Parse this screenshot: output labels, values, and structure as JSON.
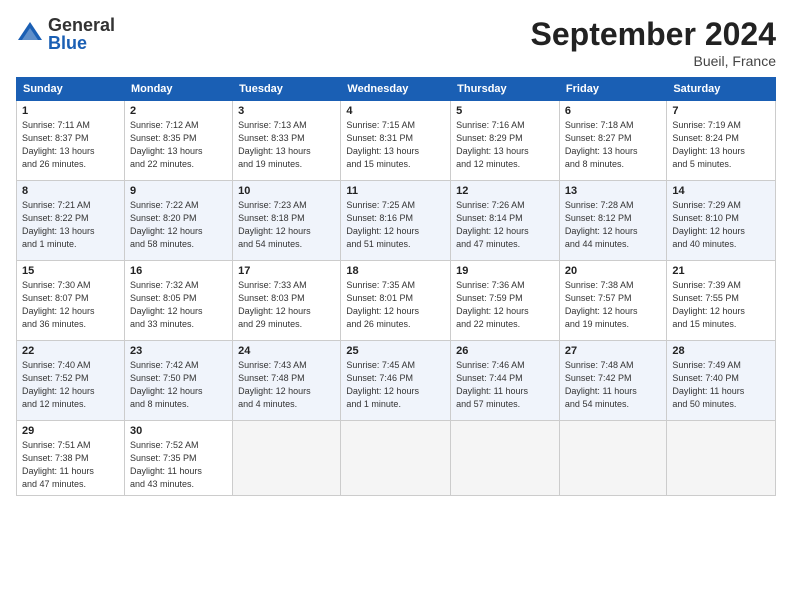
{
  "logo": {
    "general": "General",
    "blue": "Blue"
  },
  "title": "September 2024",
  "location": "Bueil, France",
  "days_of_week": [
    "Sunday",
    "Monday",
    "Tuesday",
    "Wednesday",
    "Thursday",
    "Friday",
    "Saturday"
  ],
  "weeks": [
    [
      {
        "day": "1",
        "info": "Sunrise: 7:11 AM\nSunset: 8:37 PM\nDaylight: 13 hours\nand 26 minutes."
      },
      {
        "day": "2",
        "info": "Sunrise: 7:12 AM\nSunset: 8:35 PM\nDaylight: 13 hours\nand 22 minutes."
      },
      {
        "day": "3",
        "info": "Sunrise: 7:13 AM\nSunset: 8:33 PM\nDaylight: 13 hours\nand 19 minutes."
      },
      {
        "day": "4",
        "info": "Sunrise: 7:15 AM\nSunset: 8:31 PM\nDaylight: 13 hours\nand 15 minutes."
      },
      {
        "day": "5",
        "info": "Sunrise: 7:16 AM\nSunset: 8:29 PM\nDaylight: 13 hours\nand 12 minutes."
      },
      {
        "day": "6",
        "info": "Sunrise: 7:18 AM\nSunset: 8:27 PM\nDaylight: 13 hours\nand 8 minutes."
      },
      {
        "day": "7",
        "info": "Sunrise: 7:19 AM\nSunset: 8:24 PM\nDaylight: 13 hours\nand 5 minutes."
      }
    ],
    [
      {
        "day": "8",
        "info": "Sunrise: 7:21 AM\nSunset: 8:22 PM\nDaylight: 13 hours\nand 1 minute."
      },
      {
        "day": "9",
        "info": "Sunrise: 7:22 AM\nSunset: 8:20 PM\nDaylight: 12 hours\nand 58 minutes."
      },
      {
        "day": "10",
        "info": "Sunrise: 7:23 AM\nSunset: 8:18 PM\nDaylight: 12 hours\nand 54 minutes."
      },
      {
        "day": "11",
        "info": "Sunrise: 7:25 AM\nSunset: 8:16 PM\nDaylight: 12 hours\nand 51 minutes."
      },
      {
        "day": "12",
        "info": "Sunrise: 7:26 AM\nSunset: 8:14 PM\nDaylight: 12 hours\nand 47 minutes."
      },
      {
        "day": "13",
        "info": "Sunrise: 7:28 AM\nSunset: 8:12 PM\nDaylight: 12 hours\nand 44 minutes."
      },
      {
        "day": "14",
        "info": "Sunrise: 7:29 AM\nSunset: 8:10 PM\nDaylight: 12 hours\nand 40 minutes."
      }
    ],
    [
      {
        "day": "15",
        "info": "Sunrise: 7:30 AM\nSunset: 8:07 PM\nDaylight: 12 hours\nand 36 minutes."
      },
      {
        "day": "16",
        "info": "Sunrise: 7:32 AM\nSunset: 8:05 PM\nDaylight: 12 hours\nand 33 minutes."
      },
      {
        "day": "17",
        "info": "Sunrise: 7:33 AM\nSunset: 8:03 PM\nDaylight: 12 hours\nand 29 minutes."
      },
      {
        "day": "18",
        "info": "Sunrise: 7:35 AM\nSunset: 8:01 PM\nDaylight: 12 hours\nand 26 minutes."
      },
      {
        "day": "19",
        "info": "Sunrise: 7:36 AM\nSunset: 7:59 PM\nDaylight: 12 hours\nand 22 minutes."
      },
      {
        "day": "20",
        "info": "Sunrise: 7:38 AM\nSunset: 7:57 PM\nDaylight: 12 hours\nand 19 minutes."
      },
      {
        "day": "21",
        "info": "Sunrise: 7:39 AM\nSunset: 7:55 PM\nDaylight: 12 hours\nand 15 minutes."
      }
    ],
    [
      {
        "day": "22",
        "info": "Sunrise: 7:40 AM\nSunset: 7:52 PM\nDaylight: 12 hours\nand 12 minutes."
      },
      {
        "day": "23",
        "info": "Sunrise: 7:42 AM\nSunset: 7:50 PM\nDaylight: 12 hours\nand 8 minutes."
      },
      {
        "day": "24",
        "info": "Sunrise: 7:43 AM\nSunset: 7:48 PM\nDaylight: 12 hours\nand 4 minutes."
      },
      {
        "day": "25",
        "info": "Sunrise: 7:45 AM\nSunset: 7:46 PM\nDaylight: 12 hours\nand 1 minute."
      },
      {
        "day": "26",
        "info": "Sunrise: 7:46 AM\nSunset: 7:44 PM\nDaylight: 11 hours\nand 57 minutes."
      },
      {
        "day": "27",
        "info": "Sunrise: 7:48 AM\nSunset: 7:42 PM\nDaylight: 11 hours\nand 54 minutes."
      },
      {
        "day": "28",
        "info": "Sunrise: 7:49 AM\nSunset: 7:40 PM\nDaylight: 11 hours\nand 50 minutes."
      }
    ],
    [
      {
        "day": "29",
        "info": "Sunrise: 7:51 AM\nSunset: 7:38 PM\nDaylight: 11 hours\nand 47 minutes."
      },
      {
        "day": "30",
        "info": "Sunrise: 7:52 AM\nSunset: 7:35 PM\nDaylight: 11 hours\nand 43 minutes."
      },
      {
        "day": "",
        "info": ""
      },
      {
        "day": "",
        "info": ""
      },
      {
        "day": "",
        "info": ""
      },
      {
        "day": "",
        "info": ""
      },
      {
        "day": "",
        "info": ""
      }
    ]
  ]
}
